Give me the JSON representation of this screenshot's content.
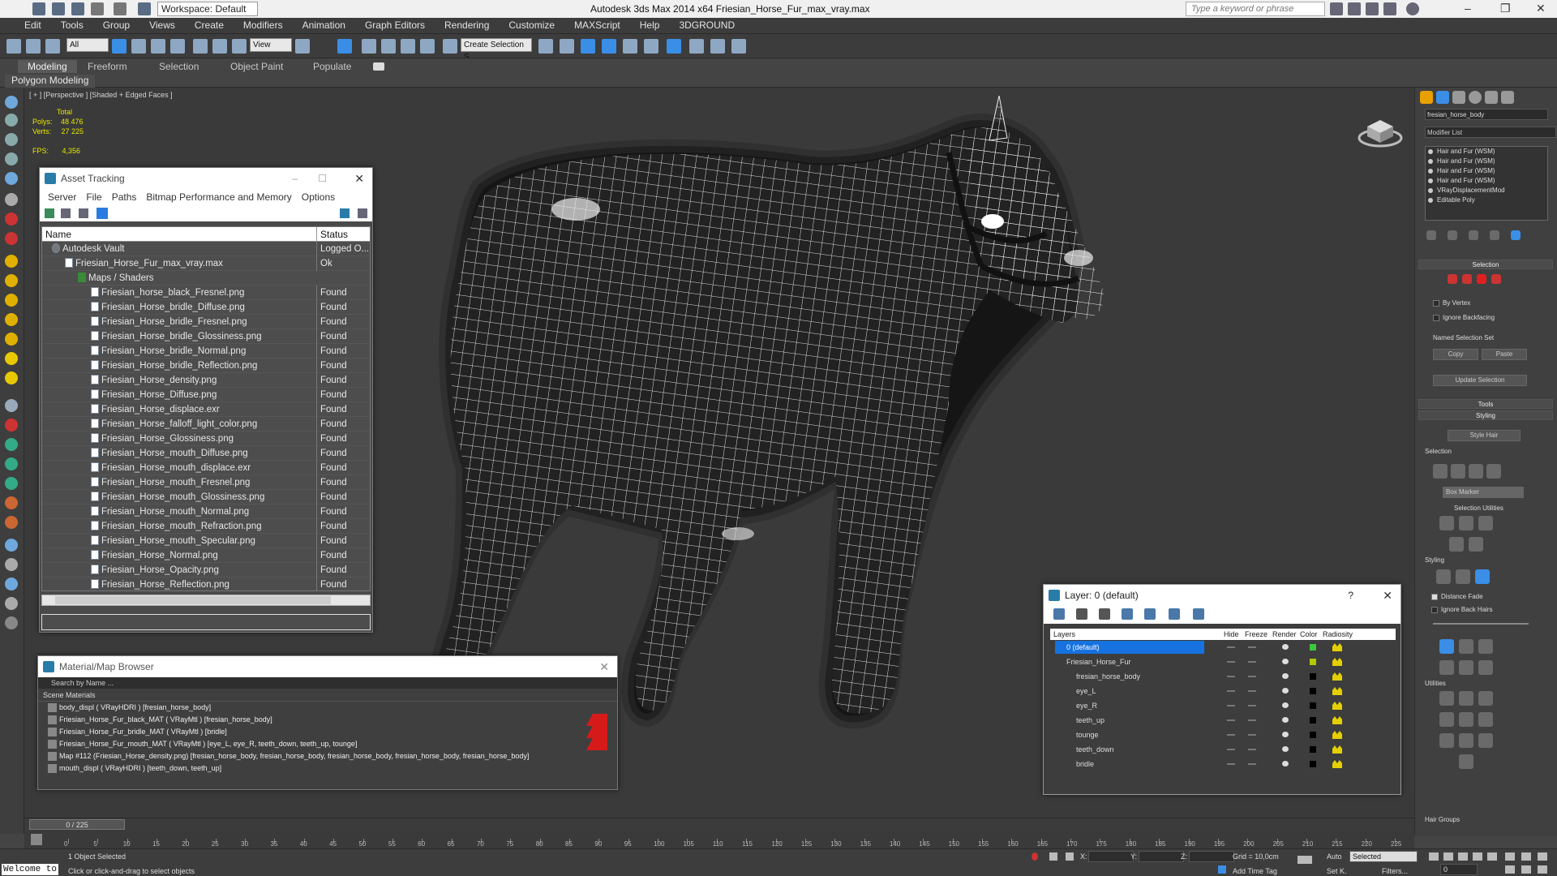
{
  "titlebar": {
    "workspace": "Workspace: Default",
    "app_title": "Autodesk 3ds Max  2014 x64     Friesian_Horse_Fur_max_vray.max",
    "search_placeholder": "Type a keyword or phrase"
  },
  "menu": [
    "Edit",
    "Tools",
    "Group",
    "Views",
    "Create",
    "Modifiers",
    "Animation",
    "Graph Editors",
    "Rendering",
    "Customize",
    "MAXScript",
    "Help",
    "3DGROUND"
  ],
  "toolbar": {
    "selection_filter": "All",
    "view_dropdown": "View",
    "named_selection": "Create Selection S"
  },
  "ribbon": {
    "tabs": [
      "Modeling",
      "Freeform",
      "Selection",
      "Object Paint",
      "Populate"
    ],
    "active_tab": "Modeling",
    "panel_label": "Polygon Modeling"
  },
  "viewport": {
    "label": "[ + ] [Perspective ] [Shaded + Edged Faces ]",
    "stats_total": "Total",
    "polys_label": "Polys:",
    "polys_value": "48 476",
    "verts_label": "Verts:",
    "verts_value": "27 225",
    "fps_label": "FPS:",
    "fps_value": "4,356"
  },
  "asset_tracking": {
    "title": "Asset Tracking",
    "menu": [
      "Server",
      "File",
      "Paths",
      "Bitmap Performance and Memory",
      "Options"
    ],
    "col_name": "Name",
    "col_status": "Status",
    "rows": [
      {
        "name": "Autodesk Vault",
        "status": "Logged O...",
        "indent": 1,
        "kind": "vault"
      },
      {
        "name": "Friesian_Horse_Fur_max_vray.max",
        "status": "Ok",
        "indent": 2,
        "kind": "max"
      },
      {
        "name": "Maps / Shaders",
        "status": "",
        "indent": 3,
        "kind": "folder"
      },
      {
        "name": "Friesian_horse_black_Fresnel.png",
        "status": "Found",
        "indent": 4,
        "kind": "file"
      },
      {
        "name": "Friesian_Horse_bridle_Diffuse.png",
        "status": "Found",
        "indent": 4,
        "kind": "file"
      },
      {
        "name": "Friesian_Horse_bridle_Fresnel.png",
        "status": "Found",
        "indent": 4,
        "kind": "file"
      },
      {
        "name": "Friesian_Horse_bridle_Glossiness.png",
        "status": "Found",
        "indent": 4,
        "kind": "file"
      },
      {
        "name": "Friesian_Horse_bridle_Normal.png",
        "status": "Found",
        "indent": 4,
        "kind": "file"
      },
      {
        "name": "Friesian_Horse_bridle_Reflection.png",
        "status": "Found",
        "indent": 4,
        "kind": "file"
      },
      {
        "name": "Friesian_Horse_density.png",
        "status": "Found",
        "indent": 4,
        "kind": "file"
      },
      {
        "name": "Friesian_Horse_Diffuse.png",
        "status": "Found",
        "indent": 4,
        "kind": "file"
      },
      {
        "name": "Friesian_Horse_displace.exr",
        "status": "Found",
        "indent": 4,
        "kind": "file"
      },
      {
        "name": "Friesian_Horse_falloff_light_color.png",
        "status": "Found",
        "indent": 4,
        "kind": "file"
      },
      {
        "name": "Friesian_Horse_Glossiness.png",
        "status": "Found",
        "indent": 4,
        "kind": "file"
      },
      {
        "name": "Friesian_Horse_mouth_Diffuse.png",
        "status": "Found",
        "indent": 4,
        "kind": "file"
      },
      {
        "name": "Friesian_Horse_mouth_displace.exr",
        "status": "Found",
        "indent": 4,
        "kind": "file"
      },
      {
        "name": "Friesian_Horse_mouth_Fresnel.png",
        "status": "Found",
        "indent": 4,
        "kind": "file"
      },
      {
        "name": "Friesian_Horse_mouth_Glossiness.png",
        "status": "Found",
        "indent": 4,
        "kind": "file"
      },
      {
        "name": "Friesian_Horse_mouth_Normal.png",
        "status": "Found",
        "indent": 4,
        "kind": "file"
      },
      {
        "name": "Friesian_Horse_mouth_Refraction.png",
        "status": "Found",
        "indent": 4,
        "kind": "file"
      },
      {
        "name": "Friesian_Horse_mouth_Specular.png",
        "status": "Found",
        "indent": 4,
        "kind": "file"
      },
      {
        "name": "Friesian_Horse_Normal.png",
        "status": "Found",
        "indent": 4,
        "kind": "file"
      },
      {
        "name": "Friesian_Horse_Opacity.png",
        "status": "Found",
        "indent": 4,
        "kind": "file"
      },
      {
        "name": "Friesian_Horse_Reflection.png",
        "status": "Found",
        "indent": 4,
        "kind": "file"
      }
    ]
  },
  "material_browser": {
    "title": "Material/Map Browser",
    "search_placeholder": "Search by Name ...",
    "section": "Scene Materials",
    "items": [
      {
        "label": "body_displ  ( VRayHDRI ) [fresian_horse_body]",
        "flag": false
      },
      {
        "label": "Friesian_Horse_Fur_black_MAT  ( VRayMtl ) [fresian_horse_body]",
        "flag": true
      },
      {
        "label": "Friesian_Horse_Fur_bridle_MAT  ( VRayMtl ) [bridle]",
        "flag": true
      },
      {
        "label": "Friesian_Horse_Fur_mouth_MAT  ( VRayMtl ) [eye_L, eye_R, teeth_down, teeth_up, tounge]",
        "flag": true
      },
      {
        "label": "Map #112 (Friesian_Horse_density.png) [fresian_horse_body, fresian_horse_body, fresian_horse_body, fresian_horse_body, fresian_horse_body]",
        "flag": false
      },
      {
        "label": "mouth_displ  ( VRayHDRI ) [teeth_down, teeth_up]",
        "flag": false
      }
    ]
  },
  "layer_dialog": {
    "title": "Layer: 0 (default)",
    "help": "?",
    "cols": {
      "layers": "Layers",
      "hide": "Hide",
      "freeze": "Freeze",
      "render": "Render",
      "color": "Color",
      "radiosity": "Radiosity"
    },
    "rows": [
      {
        "name": "0 (default)",
        "indent": 0,
        "selected": true,
        "color": "#3cc83c"
      },
      {
        "name": "Friesian_Horse_Fur",
        "indent": 0,
        "selected": false,
        "color": "#b4c800"
      },
      {
        "name": "fresian_horse_body",
        "indent": 1,
        "selected": false,
        "color": "#000000"
      },
      {
        "name": "eye_L",
        "indent": 1,
        "selected": false,
        "color": "#000000"
      },
      {
        "name": "eye_R",
        "indent": 1,
        "selected": false,
        "color": "#000000"
      },
      {
        "name": "teeth_up",
        "indent": 1,
        "selected": false,
        "color": "#000000"
      },
      {
        "name": "tounge",
        "indent": 1,
        "selected": false,
        "color": "#000000"
      },
      {
        "name": "teeth_down",
        "indent": 1,
        "selected": false,
        "color": "#000000"
      },
      {
        "name": "bridle",
        "indent": 1,
        "selected": false,
        "color": "#000000"
      }
    ]
  },
  "command_panel": {
    "object_name": "fresian_horse_body",
    "modifier_list": "Modifier List",
    "stack": [
      "Hair and Fur (WSM)",
      "Hair and Fur (WSM)",
      "Hair and Fur (WSM)",
      "Hair and Fur (WSM)",
      "VRayDisplacementMod",
      "Editable Poly"
    ],
    "selection_title": "Selection",
    "by_vertex": "By Vertex",
    "ignore_backfacing": "Ignore Backfacing",
    "named_selection_set": "Named Selection Set",
    "copy": "Copy",
    "paste": "Paste",
    "update_selection": "Update Selection",
    "tools_title": "Tools",
    "styling_title": "Styling",
    "style_hair": "Style Hair",
    "selection_sub": "Selection",
    "box_marker": "Box Marker",
    "selection_utilities": "Selection Utilities",
    "styling_sub": "Styling",
    "distance_fade": "Distance Fade",
    "ignore_back_hairs": "Ignore Back Hairs",
    "utilities": "Utilities",
    "hair_groups": "Hair Groups"
  },
  "timeline": {
    "frame_label": "0 / 225",
    "ticks": [
      0,
      5,
      10,
      15,
      20,
      25,
      30,
      35,
      40,
      45,
      50,
      55,
      60,
      65,
      70,
      75,
      80,
      85,
      90,
      95,
      100,
      105,
      110,
      115,
      120,
      125,
      130,
      135,
      140,
      145,
      150,
      155,
      160,
      165,
      170,
      175,
      180,
      185,
      190,
      195,
      200,
      205,
      210,
      215,
      220,
      225
    ]
  },
  "statusbar": {
    "welcome": "Welcome to",
    "selected": "1 Object Selected",
    "prompt": "Click or click-and-drag to select objects",
    "x_label": "X:",
    "y_label": "Y:",
    "z_label": "Z:",
    "grid": "Grid = 10,0cm",
    "add_time_tag": "Add Time Tag",
    "auto": "Auto",
    "selected_dd": "Selected",
    "set_key": "Set K.",
    "filters": "Filters...",
    "frame": "0"
  }
}
